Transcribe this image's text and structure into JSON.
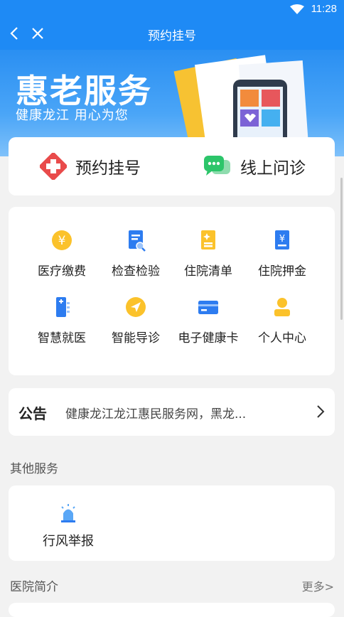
{
  "status_bar": {
    "time": "11:28"
  },
  "header": {
    "title": "预约挂号"
  },
  "banner": {
    "headline": "惠老服务",
    "subtitle": "健康龙江 用心为您"
  },
  "quick_actions": [
    {
      "label": "预约挂号",
      "icon": "red-cross-icon"
    },
    {
      "label": "线上问诊",
      "icon": "chat-bubble-icon"
    }
  ],
  "services": [
    {
      "label": "医疗缴费",
      "icon": "yuan-coin-icon"
    },
    {
      "label": "检查检验",
      "icon": "report-search-icon"
    },
    {
      "label": "住院清单",
      "icon": "document-list-icon"
    },
    {
      "label": "住院押金",
      "icon": "yuan-document-icon"
    },
    {
      "label": "智慧就医",
      "icon": "hospital-phone-icon"
    },
    {
      "label": "智能导诊",
      "icon": "navigation-icon"
    },
    {
      "label": "电子健康卡",
      "icon": "card-icon"
    },
    {
      "label": "个人中心",
      "icon": "person-icon"
    }
  ],
  "notice": {
    "tag": "公告",
    "text": "健康龙江龙江惠民服务网，黑龙..."
  },
  "other_services": {
    "title": "其他服务",
    "items": [
      {
        "label": "行风举报",
        "icon": "alarm-siren-icon"
      }
    ]
  },
  "hospital_intro": {
    "title": "医院简介",
    "more_label": "更多>"
  },
  "colors": {
    "primary": "#1e8af5",
    "red": "#e94b4b",
    "green": "#2cc56a",
    "yellow": "#fbc22b",
    "blue": "#2d7cf0"
  }
}
